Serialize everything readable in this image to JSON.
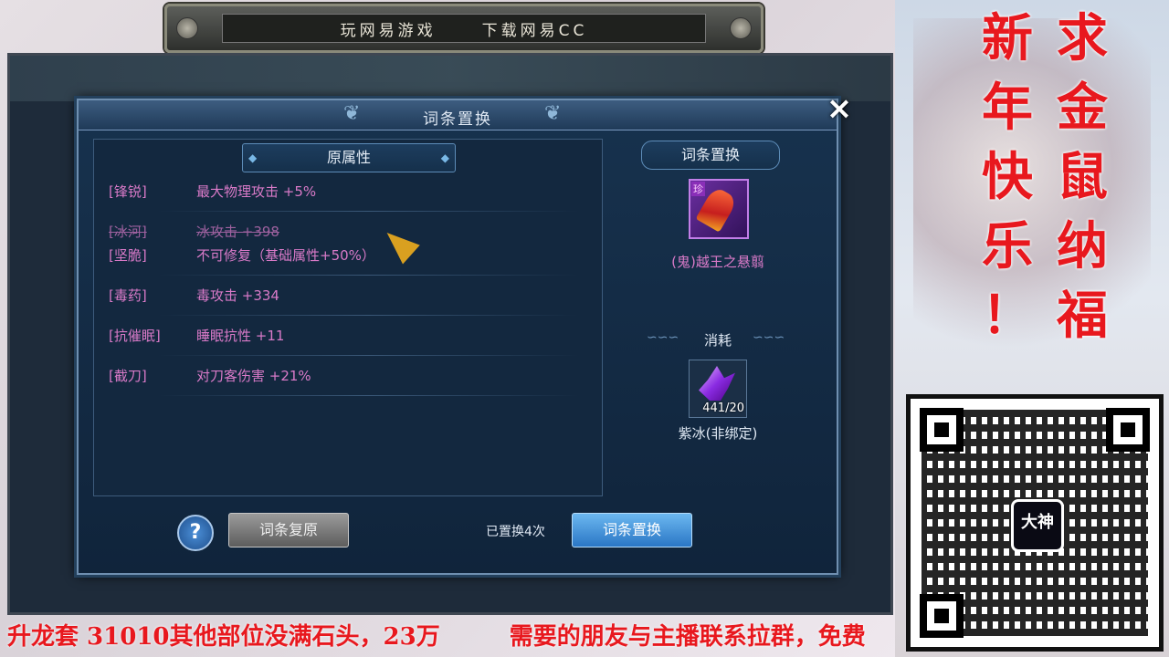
{
  "top_banner": {
    "left_text": "玩网易游戏",
    "right_text": "下载网易CC"
  },
  "dialog": {
    "title": "词条置换",
    "close": "×",
    "left_header": "原属性",
    "attributes": [
      {
        "key": "[锋锐]",
        "value": "最大物理攻击 +5%"
      },
      {
        "key": "[冰河]",
        "value": "冰攻击 +398"
      },
      {
        "key": "[坚脆]",
        "value": "不可修复（基础属性+50%）"
      },
      {
        "key": "[毒药]",
        "value": "毒攻击 +334"
      },
      {
        "key": "[抗催眠]",
        "value": "睡眠抗性 +11"
      },
      {
        "key": "[截刀]",
        "value": "对刀客伤害 +21%"
      }
    ],
    "right_header": "词条置换",
    "item": {
      "badge": "珍",
      "name": "(鬼)越王之悬翦"
    },
    "consume_label": "消耗",
    "material": {
      "count": "441/20",
      "name": "紫冰(非绑定)"
    },
    "help_label": "?",
    "restore_button": "词条复原",
    "replace_count": "已置换4次",
    "replace_button": "词条置换"
  },
  "promo": {
    "col1": [
      "新",
      "年",
      "快",
      "乐",
      "！"
    ],
    "col2": [
      "求",
      "金",
      "鼠",
      "纳",
      "福"
    ],
    "qr_logo": "大神"
  },
  "ticker": {
    "left": "升龙套 31010其他部位没满石头，23万",
    "right": "需要的朋友与主播联系拉群，免费"
  },
  "colors": {
    "accent_purple": "#d97ac8",
    "promo_red": "#e8181e",
    "button_blue": "#2a76c5"
  }
}
